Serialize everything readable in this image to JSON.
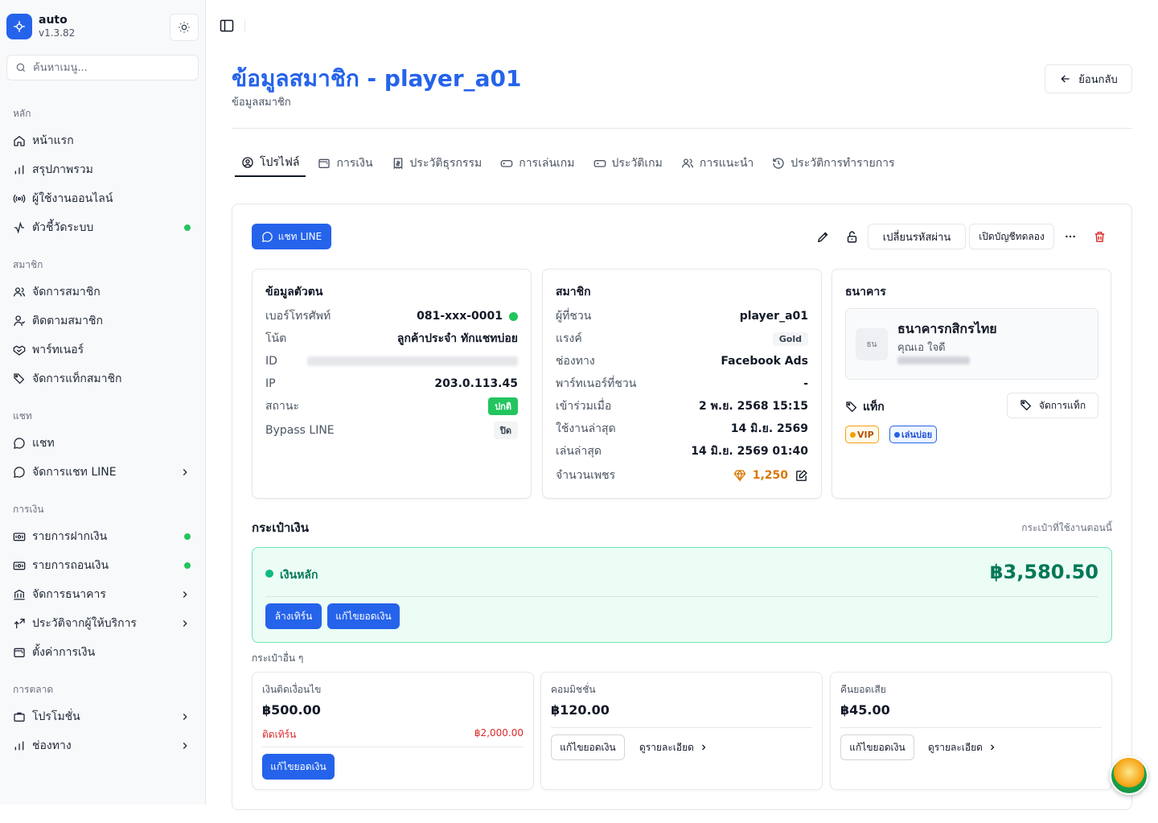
{
  "app": {
    "name": "auto",
    "version": "v1.3.82"
  },
  "search": {
    "placeholder": "ค้นหาเมนู..."
  },
  "sidebar": {
    "groups": [
      {
        "label": "หลัก",
        "items": [
          {
            "label": "หน้าแรก",
            "icon": "home-icon"
          },
          {
            "label": "สรุปภาพรวม",
            "icon": "bar-chart-icon"
          },
          {
            "label": "ผู้ใช้งานออนไลน์",
            "icon": "broadcast-icon"
          },
          {
            "label": "ตัวชี้วัดระบบ",
            "icon": "activity-icon",
            "status": "green-dot"
          }
        ]
      },
      {
        "label": "สมาชิก",
        "items": [
          {
            "label": "จัดการสมาชิก",
            "icon": "users-icon"
          },
          {
            "label": "ติดตามสมาชิก",
            "icon": "user-track-icon"
          },
          {
            "label": "พาร์ทเนอร์",
            "icon": "handshake-icon"
          },
          {
            "label": "จัดการแท็กสมาชิก",
            "icon": "tag-icon"
          }
        ]
      },
      {
        "label": "แชท",
        "items": [
          {
            "label": "แชท",
            "icon": "chat-icon"
          },
          {
            "label": "จัดการแชท LINE",
            "icon": "chat-icon",
            "chevron": true
          }
        ]
      },
      {
        "label": "การเงิน",
        "items": [
          {
            "label": "รายการฝากเงิน",
            "icon": "deposit-icon",
            "status": "green-dot"
          },
          {
            "label": "รายการถอนเงิน",
            "icon": "withdraw-icon",
            "status": "green-dot"
          },
          {
            "label": "จัดการธนาคาร",
            "icon": "bank-icon",
            "chevron": true
          },
          {
            "label": "ประวัติจากผู้ให้บริการ",
            "icon": "provider-icon",
            "chevron": true
          },
          {
            "label": "ตั้งค่าการเงิน",
            "icon": "wallet-icon"
          }
        ]
      },
      {
        "label": "การตลาด",
        "items": [
          {
            "label": "โปรโมชั่น",
            "icon": "briefcase-icon",
            "chevron": true
          },
          {
            "label": "ช่องทาง",
            "icon": "bar-chart-icon",
            "chevron": true
          }
        ]
      }
    ]
  },
  "page": {
    "title": "ข้อมูลสมาชิก - player_a01",
    "subtitle": "ข้อมูลสมาชิก",
    "back_label": "ย้อนกลับ"
  },
  "tabs": [
    {
      "label": "โปรไฟล์",
      "icon": "user-circle-icon",
      "active": true
    },
    {
      "label": "การเงิน",
      "icon": "wallet-icon"
    },
    {
      "label": "ประวัติธุรกรรม",
      "icon": "receipt-icon"
    },
    {
      "label": "การเล่นเกม",
      "icon": "gamepad-icon"
    },
    {
      "label": "ประวัติเกม",
      "icon": "game-history-icon"
    },
    {
      "label": "การแนะนำ",
      "icon": "users-icon"
    },
    {
      "label": "ประวัติการทำรายการ",
      "icon": "history-icon"
    }
  ],
  "actions": {
    "chat_line": "แชท LINE",
    "change_password": "เปลี่ยนรหัสผ่าน",
    "open_trial": "เปิดบัญชีทดลอง"
  },
  "identity": {
    "title": "ข้อมูลตัวตน",
    "rows": [
      {
        "k": "เบอร์โทรศัพท์",
        "v": "081-xxx-0001"
      },
      {
        "k": "โน้ต",
        "v": "ลูกค้าประจำ ทักแชทบ่อย"
      },
      {
        "k": "ID",
        "v": ""
      },
      {
        "k": "IP",
        "v": "203.0.113.45"
      },
      {
        "k": "สถานะ",
        "v": "ปกติ"
      },
      {
        "k": "Bypass LINE",
        "v": "ปิด"
      }
    ]
  },
  "member": {
    "title": "สมาชิก",
    "rows": [
      {
        "k": "ผู้ที่ชวน",
        "v": "player_a01"
      },
      {
        "k": "แรงค์",
        "v": "Gold"
      },
      {
        "k": "ช่องทาง",
        "v": "Facebook Ads"
      },
      {
        "k": "พาร์ทเนอร์ที่ชวน",
        "v": "-"
      },
      {
        "k": "เข้าร่วมเมื่อ",
        "v": "2 พ.ย. 2568 15:15"
      },
      {
        "k": "ใช้งานล่าสุด",
        "v": "14 มิ.ย. 2569"
      },
      {
        "k": "เล่นล่าสุด",
        "v": "14 มิ.ย. 2569 01:40"
      },
      {
        "k": "จำนวนเพชร",
        "v": "1,250"
      }
    ]
  },
  "bank": {
    "title": "ธนาคาร",
    "logo_text": "ธน",
    "name": "ธนาคารกสิกรไทย",
    "owner": "คุณเอ ใจดี",
    "tag_label": "แท็ก",
    "manage_tags": "จัดการแท็ก",
    "tags": [
      {
        "label": "VIP",
        "color": "#f59e0b"
      },
      {
        "label": "เล่นบ่อย",
        "color": "#2563eb"
      }
    ]
  },
  "wallet": {
    "title": "กระเป๋าเงิน",
    "hint": "กระเป๋าที่ใช้งานตอนนี้",
    "main_label": "เงินหลัก",
    "main_amount": "฿3,580.50",
    "clear_turnover": "ล้างเทิร์น",
    "edit_balance": "แก้ไขยอดเงิน",
    "other_label": "กระเป๋าอื่น ๆ",
    "others": [
      {
        "label": "เงินติดเงื่อนไข",
        "amount": "฿500.00",
        "turn_label": "ติดเทิร์น",
        "turn_value": "฿2,000.00",
        "button": "แก้ไขยอดเงิน"
      },
      {
        "label": "คอมมิชชั่น",
        "amount": "฿120.00",
        "button": "แก้ไขยอดเงิน",
        "detail": "ดูรายละเอียด"
      },
      {
        "label": "คืนยอดเสีย",
        "amount": "฿45.00",
        "button": "แก้ไขยอดเงิน",
        "detail": "ดูรายละเอียด"
      }
    ]
  },
  "colors": {
    "accent": "#2563eb",
    "success": "#22c55e",
    "danger": "#dc2626",
    "wallet_green": "#047857"
  }
}
